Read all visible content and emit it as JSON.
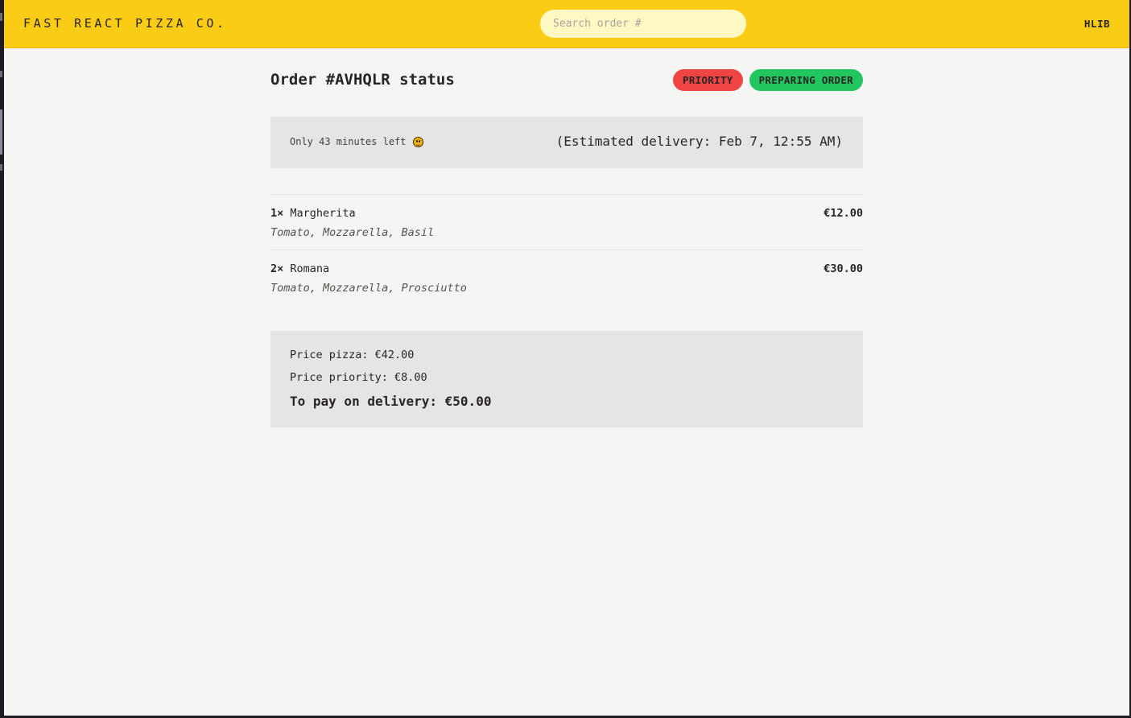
{
  "header": {
    "logo": "FAST REACT PIZZA CO.",
    "search_placeholder": "Search order #",
    "search_value": "",
    "username": "HLIB"
  },
  "order": {
    "title": "Order #AVHQLR status",
    "badges": {
      "priority": "PRIORITY",
      "status": "PREPARING ORDER"
    },
    "eta": {
      "remaining": "Only 43 minutes left",
      "emoji_icon": "smiling-face-icon",
      "estimated": "(Estimated delivery: Feb 7, 12:55 AM)"
    },
    "items": [
      {
        "quantity": "1×",
        "name": "Margherita",
        "price": "€12.00",
        "ingredients": "Tomato, Mozzarella, Basil"
      },
      {
        "quantity": "2×",
        "name": "Romana",
        "price": "€30.00",
        "ingredients": "Tomato, Mozzarella, Prosciutto"
      }
    ],
    "summary": {
      "price_pizza": "Price pizza: €42.00",
      "price_priority": "Price priority: €8.00",
      "to_pay": "To pay on delivery: €50.00"
    }
  },
  "colors": {
    "header_bg": "#facc15",
    "search_bg": "#fef9c3",
    "page_bg": "#f5f5f4",
    "panel_bg": "#e7e5e4",
    "priority_badge": "#ef4444",
    "status_badge": "#22c55e",
    "text": "#292524"
  }
}
